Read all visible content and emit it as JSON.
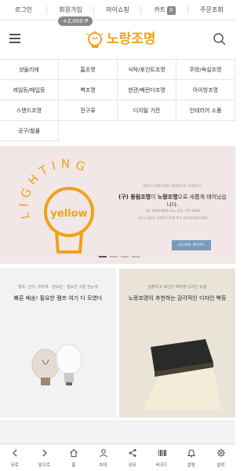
{
  "top_links": {
    "login": "로그인",
    "join": "회원가입",
    "mypage": "마이쇼핑",
    "cart": "카트",
    "cart_count": "0",
    "order_lookup": "주문조회",
    "points": "+2,000 P"
  },
  "header": {
    "logo_text": "노랑조명"
  },
  "categories": [
    "샹들리에",
    "홈조명",
    "식탁/포인트조명",
    "주방/욕실조명",
    "레일등/매입등",
    "벽조명",
    "현관/베란다조명",
    "아이방조명",
    "스탠드조명",
    "전구류",
    "디지털 가전",
    "인테리어 소품",
    "공구/철물"
  ],
  "hero": {
    "lighting_text": "LIGHTING",
    "bulb_text": "yellow",
    "tiny_line_1": "세련된 시대관 언제나 설레임으로 기억됩니다.",
    "main_prefix": "(구) 동림조명",
    "main_mid": "이 ",
    "main_brand": "노랑조명",
    "main_suffix": "으로 새롭게 태어났습니다.",
    "tiny_line_2": "Tel. 1899-9906    Fax. 031-767-4888",
    "tiny_line_3": "부산시 동래구 동래로 도로명 주소 본사(부원빌딩5층)",
    "button_label": "LEARN MORE"
  },
  "promos": [
    {
      "small": "램프, 전구, 부자재 · 필요한 · 필요한 것을 한눈에",
      "title": "빠른 배송! 필요한 램프 여기 다 모였다"
    },
    {
      "small": "심플하고 모던한 벽조명 디자인 모음",
      "title": "노랑조명이 추천하는 감각적인 디자인 벽등"
    }
  ],
  "bottom_nav": [
    "뒤로",
    "앞으로",
    "홈",
    "초대",
    "공유",
    "바코드",
    "알림",
    "설정"
  ],
  "colors": {
    "brand": "#f0a21b",
    "hero_bg": "#f1e7e6",
    "button": "#7a99b8"
  }
}
